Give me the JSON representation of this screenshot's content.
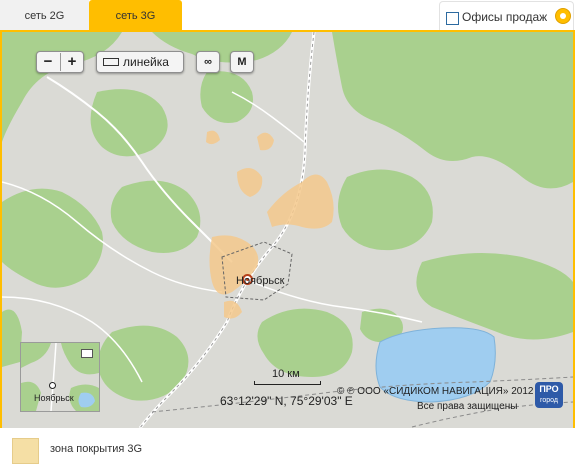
{
  "tabs": [
    {
      "label": "сеть 2G",
      "active": false
    },
    {
      "label": "сеть 3G",
      "active": true
    }
  ],
  "offices_checkbox": {
    "label": "Офисы продаж",
    "checked": false
  },
  "map": {
    "controls": {
      "zoom_out": "−",
      "zoom_in": "+",
      "ruler_label": "линейка",
      "link_icon": "link-icon",
      "metro_icon": "metro-icon"
    },
    "city_label": "Ноябрьск",
    "minimap": {
      "city_label": "Ноябрьск"
    },
    "scale_label": "10 км",
    "coordinates": "63°12'29\" N, 75°29'03\" E",
    "copyright": "© ℗ ООО «СИДИКОМ НАВИГАЦИЯ» 2012",
    "rights": "Все права защищены",
    "pro_logo": {
      "top": "ПРО",
      "bottom": "город"
    }
  },
  "legend": {
    "label": "зона покрытия 3G",
    "color": "#f5dfa5"
  },
  "colors": {
    "accent": "#ffbe00",
    "forest": "#a9d08e",
    "water": "#9fcdf0",
    "coverage": "#f5c98d"
  }
}
